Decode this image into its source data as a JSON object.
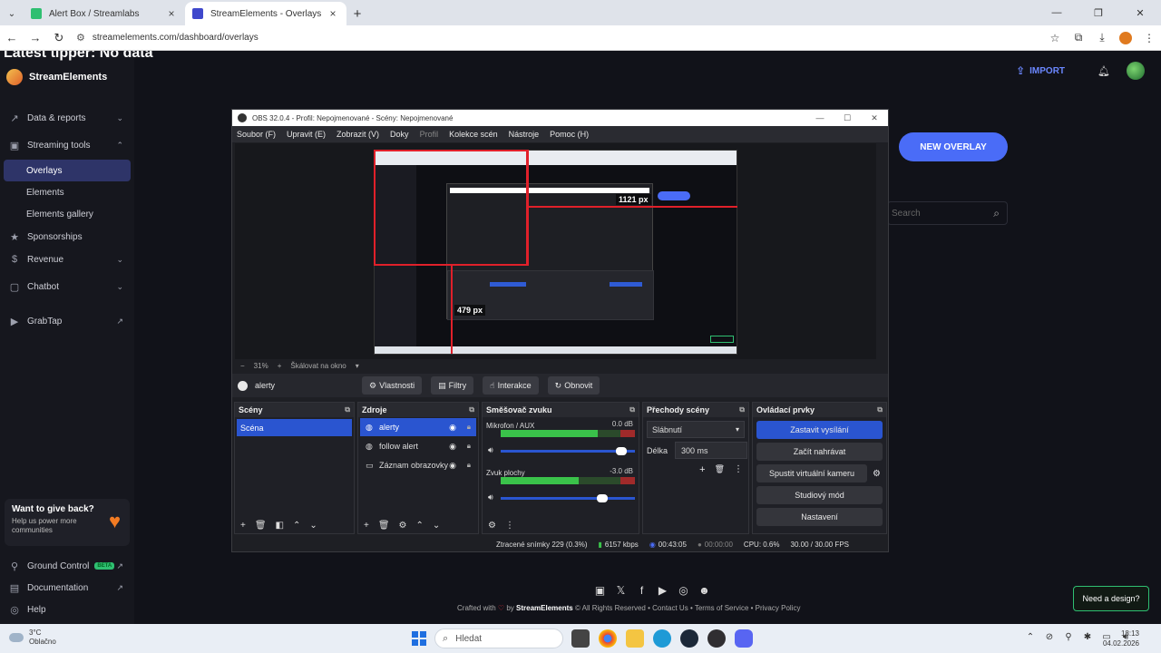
{
  "browser": {
    "tabs": [
      {
        "label": "Alert Box / Streamlabs",
        "active": false
      },
      {
        "label": "StreamElements - Overlays",
        "active": true
      }
    ],
    "url": "streamelements.com/dashboard/overlays"
  },
  "page": {
    "ticker_text": "Latest tipper: No data",
    "brand": "StreamElements",
    "import_label": "IMPORT",
    "new_overlay_label": "NEW OVERLAY",
    "search_placeholder": "Search",
    "nav": {
      "data_reports": "Data & reports",
      "streaming_tools": "Streaming tools",
      "overlays": "Overlays",
      "elements": "Elements",
      "elements_gallery": "Elements gallery",
      "sponsorships": "Sponsorships",
      "revenue": "Revenue",
      "chatbot": "Chatbot",
      "grabtap": "GrabTap"
    },
    "give_back": {
      "title": "Want to give back?",
      "subtitle": "Help us power more communities"
    },
    "footer_nav": {
      "ground_control": "Ground Control",
      "beta": "BETA",
      "documentation": "Documentation",
      "help": "Help"
    },
    "credits": {
      "crafted_with": "Crafted with",
      "by": "by",
      "brand": "StreamElements",
      "rights": "© All Rights Reserved",
      "contact": "Contact Us",
      "terms": "Terms of Service",
      "privacy": "Privacy Policy"
    },
    "need_design": "Need a design?"
  },
  "obs": {
    "title": "OBS 32.0.4 - Profil: Nepojmenované - Scény: Nepojmenované",
    "menu": [
      "Soubor (F)",
      "Upravit (E)",
      "Zobrazit (V)",
      "Doky",
      "Profil",
      "Kolekce scén",
      "Nástroje",
      "Pomoc (H)"
    ],
    "preview": {
      "width_label": "1121 px",
      "height_label": "479 px"
    },
    "zoom": {
      "minus": "−",
      "percent": "31%",
      "plus": "+",
      "fit": "Škálovat na okno"
    },
    "source_bar": {
      "name": "alerty",
      "properties": "Vlastnosti",
      "filters": "Filtry",
      "interact": "Interakce",
      "refresh": "Obnovit"
    },
    "scenes": {
      "title": "Scény",
      "items": [
        "Scéna"
      ]
    },
    "sources": {
      "title": "Zdroje",
      "items": [
        "alerty",
        "follow alert",
        "Záznam obrazovky"
      ]
    },
    "mixer": {
      "title": "Směšovač zvuku",
      "channels": [
        {
          "name": "Mikrofon / AUX",
          "db": "0.0 dB",
          "level": 0.72,
          "volume": 0.94
        },
        {
          "name": "Zvuk plochy",
          "db": "-3.0 dB",
          "level": 0.58,
          "volume": 0.8
        }
      ]
    },
    "transitions": {
      "title": "Přechody scény",
      "selected": "Slábnutí",
      "duration_label": "Délka",
      "duration_value": "300 ms"
    },
    "controls": {
      "title": "Ovládací prvky",
      "buttons": [
        "Zastavit vysílání",
        "Začít nahrávat",
        "Spustit virtuální kameru",
        "Studiový mód",
        "Nastavení"
      ]
    },
    "status": {
      "dropped": "Ztracené snímky 229 (0.3%)",
      "bitrate": "6157 kbps",
      "stream_time": "00:43:05",
      "rec_time": "00:00:00",
      "cpu": "CPU: 0.6%",
      "fps": "30.00 / 30.00 FPS"
    }
  },
  "taskbar": {
    "weather_temp": "3°C",
    "weather_text": "Oblačno",
    "search_label": "Hledat",
    "time": "18:13",
    "date": "04.02.2026"
  }
}
